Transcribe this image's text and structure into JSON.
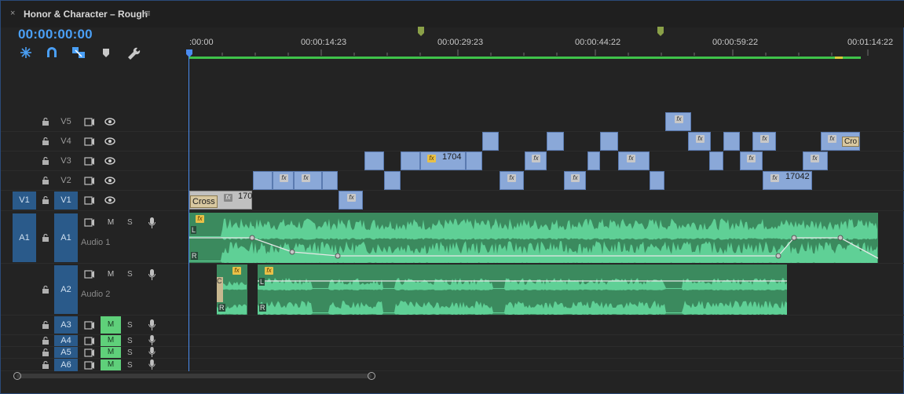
{
  "header": {
    "close_glyph": "×",
    "title": "Honor & Character – Rough",
    "menu_glyph": "≡"
  },
  "timecode": "00:00:00:00",
  "toolbar": {
    "icons": [
      "snap-in-nest-icon",
      "magnet-snap-icon",
      "linked-selection-icon",
      "add-marker-icon",
      "wrench-settings-icon"
    ]
  },
  "ruler": {
    "labels": [
      ":00:00",
      "00:00:14:23",
      "00:00:29:23",
      "00:00:44:22",
      "00:00:59:22",
      "00:01:14:22"
    ]
  },
  "tracks": {
    "video": [
      {
        "name": "V5",
        "source": ""
      },
      {
        "name": "V4",
        "source": ""
      },
      {
        "name": "V3",
        "source": ""
      },
      {
        "name": "V2",
        "source": ""
      },
      {
        "name": "V1",
        "source": "V1"
      }
    ],
    "audio": [
      {
        "name": "A1",
        "source": "A1",
        "label": "Audio 1",
        "m": "M",
        "s": "S"
      },
      {
        "name": "A2",
        "source": "",
        "label": "Audio 2",
        "m": "M",
        "s": "S"
      },
      {
        "name": "A3",
        "source": "",
        "m": "M",
        "s": "S"
      },
      {
        "name": "A4",
        "source": "",
        "m": "M",
        "s": "S"
      },
      {
        "name": "A5",
        "source": "",
        "m": "M",
        "s": "S"
      },
      {
        "name": "A6",
        "source": "",
        "m": "M",
        "s": "S"
      }
    ]
  },
  "clips": {
    "fx": "fx",
    "v3_label": "1704",
    "v2_label": "17042",
    "v1_label": "170",
    "v1_transition": "Cross",
    "v4_transition": "Cro",
    "channel_l": "L",
    "channel_r": "R",
    "a2_small": "C"
  },
  "colors": {
    "accent": "#4a9ff5",
    "video_clip": "#8aa8d8",
    "audio_clip": "#3b8a5e",
    "waveform": "#5fd096",
    "mute_on": "#5fd07a"
  }
}
